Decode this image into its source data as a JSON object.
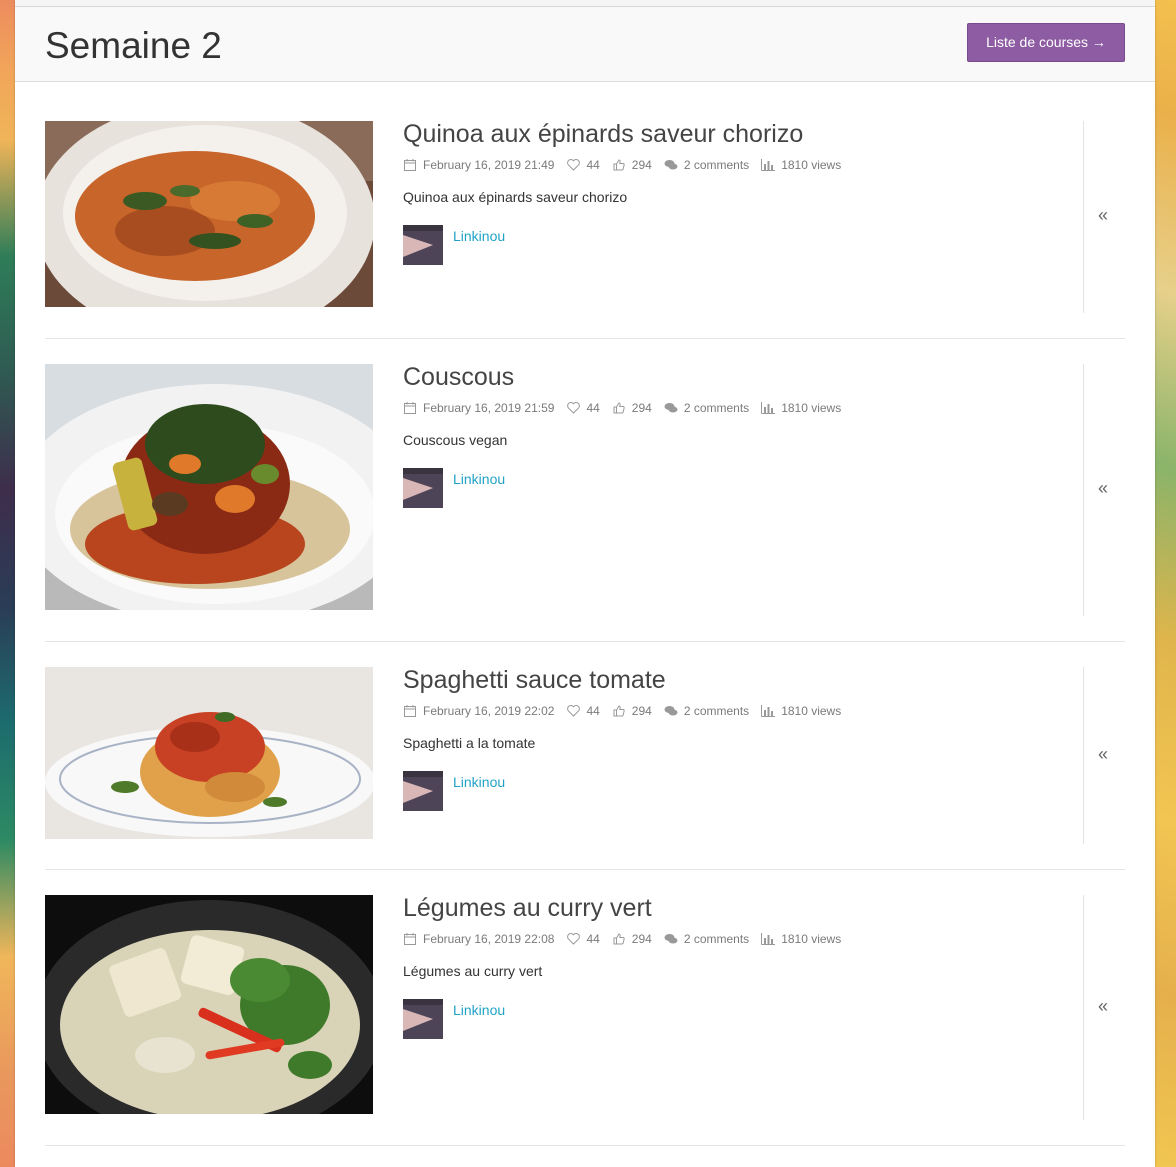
{
  "page": {
    "title": "Semaine 2",
    "shopping_button": "Liste de courses →"
  },
  "recipes": [
    {
      "title": "Quinoa aux épinards saveur chorizo",
      "date": "February 16, 2019 21:49",
      "likes": "44",
      "thumbs": "294",
      "comments": "2 comments",
      "views": "1810 views",
      "description": "Quinoa aux épinards saveur chorizo",
      "author": "Linkinou"
    },
    {
      "title": "Couscous",
      "date": "February 16, 2019 21:59",
      "likes": "44",
      "thumbs": "294",
      "comments": "2 comments",
      "views": "1810 views",
      "description": "Couscous vegan",
      "author": "Linkinou"
    },
    {
      "title": "Spaghetti sauce tomate",
      "date": "February 16, 2019 22:02",
      "likes": "44",
      "thumbs": "294",
      "comments": "2 comments",
      "views": "1810 views",
      "description": "Spaghetti a la tomate",
      "author": "Linkinou"
    },
    {
      "title": "Légumes au curry vert",
      "date": "February 16, 2019 22:08",
      "likes": "44",
      "thumbs": "294",
      "comments": "2 comments",
      "views": "1810 views",
      "description": "Légumes au curry vert",
      "author": "Linkinou"
    }
  ],
  "icons": {
    "date": "calendar-icon",
    "likes": "heart-icon",
    "thumbs": "thumbs-up-icon",
    "comments": "comments-icon",
    "views": "bar-chart-icon",
    "side": "double-chevron-left-icon"
  },
  "colors": {
    "accent_button": "#8e5ca3",
    "author_link": "#22a3c6"
  }
}
